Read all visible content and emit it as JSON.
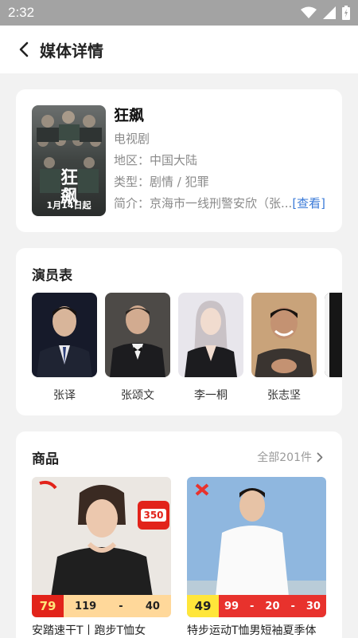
{
  "status": {
    "time": "2:32"
  },
  "header": {
    "title": "媒体详情"
  },
  "media": {
    "name": "狂飙",
    "category": "电视剧",
    "region": "地区：中国大陆",
    "genre": "类型：剧情 / 犯罪",
    "summary": "简介：京海市一线刑警安欣（张...",
    "see_more": "[查看]",
    "poster_text": "狂飙",
    "poster_date": "1月14日起"
  },
  "cast": {
    "title": "演员表",
    "members": [
      {
        "name": "张译"
      },
      {
        "name": "张颂文"
      },
      {
        "name": "李一桐"
      },
      {
        "name": "张志坚"
      }
    ]
  },
  "goods": {
    "title": "商品",
    "all_label": "全部201件",
    "items": [
      {
        "title": "安踏速干T丨跑步T恤女",
        "price": "79",
        "prices": [
          "119",
          "40"
        ],
        "badge": "350",
        "accent": "#e2231a"
      },
      {
        "title": "特步运动T恤男短袖夏季体",
        "price": "49",
        "prices": [
          "99",
          "20",
          "30"
        ],
        "accent": "#e8322d"
      }
    ]
  }
}
